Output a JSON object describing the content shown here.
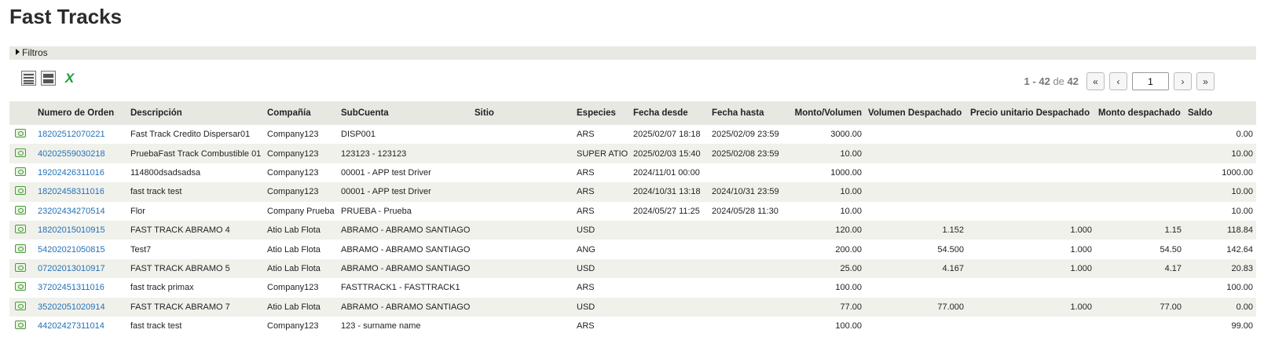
{
  "page_title": "Fast Tracks",
  "filters": {
    "label": "Filtros"
  },
  "toolbar": {
    "icons": [
      "detailed-view-icon",
      "compact-view-icon",
      "excel-export-icon"
    ],
    "excel_glyph": "X"
  },
  "pager": {
    "range_start": "1",
    "range_sep": "-",
    "range_end": "42",
    "of_label": "de",
    "total": "42",
    "first_label": "«",
    "prev_label": "‹",
    "page_value": "1",
    "next_label": "›",
    "last_label": "»"
  },
  "table": {
    "columns": [
      "Numero de Orden",
      "Descripción",
      "Compañía",
      "SubCuenta",
      "Sitio",
      "Especies",
      "Fecha desde",
      "Fecha hasta",
      "Monto/Volumen",
      "Volumen Despachado",
      "Precio unitario Despachado",
      "Monto despachado",
      "Saldo"
    ],
    "rows": [
      {
        "orden": "18202512070221",
        "descripcion": "Fast Track Credito Dispersar01",
        "compania": "Company123",
        "subcuenta": "DISP001",
        "sitio": "",
        "especies": "ARS",
        "desde": "2025/02/07 18:18",
        "hasta": "2025/02/09 23:59",
        "monto": "3000.00",
        "vol_desp": "",
        "precio": "",
        "monto_desp": "",
        "saldo": "0.00"
      },
      {
        "orden": "40202559030218",
        "descripcion": "PruebaFast Track Combustible 01",
        "compania": "Company123",
        "subcuenta": "123123 - 123123",
        "sitio": "",
        "especies": "SUPER ATIO",
        "desde": "2025/02/03 15:40",
        "hasta": "2025/02/08 23:59",
        "monto": "10.00",
        "vol_desp": "",
        "precio": "",
        "monto_desp": "",
        "saldo": "10.00"
      },
      {
        "orden": "19202426311016",
        "descripcion": "114800dsadsadsa",
        "compania": "Company123",
        "subcuenta": "00001 - APP test Driver",
        "sitio": "",
        "especies": "ARS",
        "desde": "2024/11/01 00:00",
        "hasta": "",
        "monto": "1000.00",
        "vol_desp": "",
        "precio": "",
        "monto_desp": "",
        "saldo": "1000.00"
      },
      {
        "orden": "18202458311016",
        "descripcion": "fast track test",
        "compania": "Company123",
        "subcuenta": "00001 - APP test Driver",
        "sitio": "",
        "especies": "ARS",
        "desde": "2024/10/31 13:18",
        "hasta": "2024/10/31 23:59",
        "monto": "10.00",
        "vol_desp": "",
        "precio": "",
        "monto_desp": "",
        "saldo": "10.00"
      },
      {
        "orden": "23202434270514",
        "descripcion": "Flor",
        "compania": "Company Prueba",
        "subcuenta": "PRUEBA - Prueba",
        "sitio": "",
        "especies": "ARS",
        "desde": "2024/05/27 11:25",
        "hasta": "2024/05/28 11:30",
        "monto": "10.00",
        "vol_desp": "",
        "precio": "",
        "monto_desp": "",
        "saldo": "10.00"
      },
      {
        "orden": "18202015010915",
        "descripcion": "FAST TRACK ABRAMO 4",
        "compania": "Atio Lab Flota",
        "subcuenta": "ABRAMO - ABRAMO SANTIAGO",
        "sitio": "",
        "especies": "USD",
        "desde": "",
        "hasta": "",
        "monto": "120.00",
        "vol_desp": "1.152",
        "precio": "1.000",
        "monto_desp": "1.15",
        "saldo": "118.84"
      },
      {
        "orden": "54202021050815",
        "descripcion": "Test7",
        "compania": "Atio Lab Flota",
        "subcuenta": "ABRAMO - ABRAMO SANTIAGO",
        "sitio": "",
        "especies": "ANG",
        "desde": "",
        "hasta": "",
        "monto": "200.00",
        "vol_desp": "54.500",
        "precio": "1.000",
        "monto_desp": "54.50",
        "saldo": "142.64"
      },
      {
        "orden": "07202013010917",
        "descripcion": "FAST TRACK ABRAMO 5",
        "compania": "Atio Lab Flota",
        "subcuenta": "ABRAMO - ABRAMO SANTIAGO",
        "sitio": "",
        "especies": "USD",
        "desde": "",
        "hasta": "",
        "monto": "25.00",
        "vol_desp": "4.167",
        "precio": "1.000",
        "monto_desp": "4.17",
        "saldo": "20.83"
      },
      {
        "orden": "37202451311016",
        "descripcion": "fast track primax",
        "compania": "Company123",
        "subcuenta": "FASTTRACK1 - FASTTRACK1",
        "sitio": "",
        "especies": "ARS",
        "desde": "",
        "hasta": "",
        "monto": "100.00",
        "vol_desp": "",
        "precio": "",
        "monto_desp": "",
        "saldo": "100.00"
      },
      {
        "orden": "35202051020914",
        "descripcion": "FAST TRACK ABRAMO 7",
        "compania": "Atio Lab Flota",
        "subcuenta": "ABRAMO - ABRAMO SANTIAGO",
        "sitio": "",
        "especies": "USD",
        "desde": "",
        "hasta": "",
        "monto": "77.00",
        "vol_desp": "77.000",
        "precio": "1.000",
        "monto_desp": "77.00",
        "saldo": "0.00"
      },
      {
        "orden": "44202427311014",
        "descripcion": "fast track test",
        "compania": "Company123",
        "subcuenta": "123 - surname name",
        "sitio": "",
        "especies": "ARS",
        "desde": "",
        "hasta": "",
        "monto": "100.00",
        "vol_desp": "",
        "precio": "",
        "monto_desp": "",
        "saldo": "99.00"
      }
    ]
  }
}
